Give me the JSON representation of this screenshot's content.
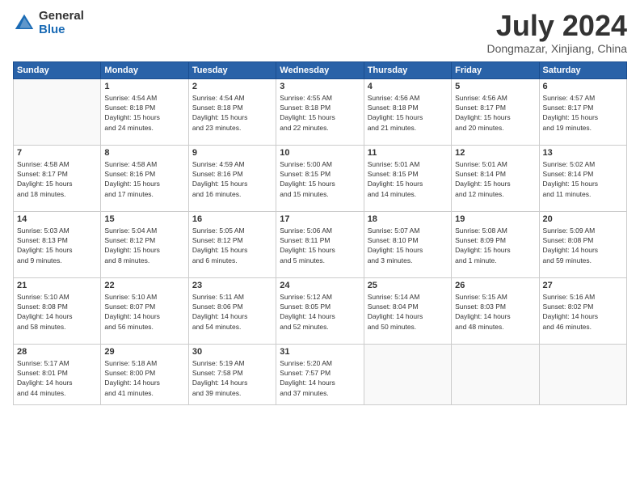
{
  "logo": {
    "general": "General",
    "blue": "Blue"
  },
  "title": "July 2024",
  "subtitle": "Dongmazar, Xinjiang, China",
  "weekdays": [
    "Sunday",
    "Monday",
    "Tuesday",
    "Wednesday",
    "Thursday",
    "Friday",
    "Saturday"
  ],
  "weeks": [
    [
      {
        "day": "",
        "info": ""
      },
      {
        "day": "1",
        "info": "Sunrise: 4:54 AM\nSunset: 8:18 PM\nDaylight: 15 hours\nand 24 minutes."
      },
      {
        "day": "2",
        "info": "Sunrise: 4:54 AM\nSunset: 8:18 PM\nDaylight: 15 hours\nand 23 minutes."
      },
      {
        "day": "3",
        "info": "Sunrise: 4:55 AM\nSunset: 8:18 PM\nDaylight: 15 hours\nand 22 minutes."
      },
      {
        "day": "4",
        "info": "Sunrise: 4:56 AM\nSunset: 8:18 PM\nDaylight: 15 hours\nand 21 minutes."
      },
      {
        "day": "5",
        "info": "Sunrise: 4:56 AM\nSunset: 8:17 PM\nDaylight: 15 hours\nand 20 minutes."
      },
      {
        "day": "6",
        "info": "Sunrise: 4:57 AM\nSunset: 8:17 PM\nDaylight: 15 hours\nand 19 minutes."
      }
    ],
    [
      {
        "day": "7",
        "info": "Sunrise: 4:58 AM\nSunset: 8:17 PM\nDaylight: 15 hours\nand 18 minutes."
      },
      {
        "day": "8",
        "info": "Sunrise: 4:58 AM\nSunset: 8:16 PM\nDaylight: 15 hours\nand 17 minutes."
      },
      {
        "day": "9",
        "info": "Sunrise: 4:59 AM\nSunset: 8:16 PM\nDaylight: 15 hours\nand 16 minutes."
      },
      {
        "day": "10",
        "info": "Sunrise: 5:00 AM\nSunset: 8:15 PM\nDaylight: 15 hours\nand 15 minutes."
      },
      {
        "day": "11",
        "info": "Sunrise: 5:01 AM\nSunset: 8:15 PM\nDaylight: 15 hours\nand 14 minutes."
      },
      {
        "day": "12",
        "info": "Sunrise: 5:01 AM\nSunset: 8:14 PM\nDaylight: 15 hours\nand 12 minutes."
      },
      {
        "day": "13",
        "info": "Sunrise: 5:02 AM\nSunset: 8:14 PM\nDaylight: 15 hours\nand 11 minutes."
      }
    ],
    [
      {
        "day": "14",
        "info": "Sunrise: 5:03 AM\nSunset: 8:13 PM\nDaylight: 15 hours\nand 9 minutes."
      },
      {
        "day": "15",
        "info": "Sunrise: 5:04 AM\nSunset: 8:12 PM\nDaylight: 15 hours\nand 8 minutes."
      },
      {
        "day": "16",
        "info": "Sunrise: 5:05 AM\nSunset: 8:12 PM\nDaylight: 15 hours\nand 6 minutes."
      },
      {
        "day": "17",
        "info": "Sunrise: 5:06 AM\nSunset: 8:11 PM\nDaylight: 15 hours\nand 5 minutes."
      },
      {
        "day": "18",
        "info": "Sunrise: 5:07 AM\nSunset: 8:10 PM\nDaylight: 15 hours\nand 3 minutes."
      },
      {
        "day": "19",
        "info": "Sunrise: 5:08 AM\nSunset: 8:09 PM\nDaylight: 15 hours\nand 1 minute."
      },
      {
        "day": "20",
        "info": "Sunrise: 5:09 AM\nSunset: 8:08 PM\nDaylight: 14 hours\nand 59 minutes."
      }
    ],
    [
      {
        "day": "21",
        "info": "Sunrise: 5:10 AM\nSunset: 8:08 PM\nDaylight: 14 hours\nand 58 minutes."
      },
      {
        "day": "22",
        "info": "Sunrise: 5:10 AM\nSunset: 8:07 PM\nDaylight: 14 hours\nand 56 minutes."
      },
      {
        "day": "23",
        "info": "Sunrise: 5:11 AM\nSunset: 8:06 PM\nDaylight: 14 hours\nand 54 minutes."
      },
      {
        "day": "24",
        "info": "Sunrise: 5:12 AM\nSunset: 8:05 PM\nDaylight: 14 hours\nand 52 minutes."
      },
      {
        "day": "25",
        "info": "Sunrise: 5:14 AM\nSunset: 8:04 PM\nDaylight: 14 hours\nand 50 minutes."
      },
      {
        "day": "26",
        "info": "Sunrise: 5:15 AM\nSunset: 8:03 PM\nDaylight: 14 hours\nand 48 minutes."
      },
      {
        "day": "27",
        "info": "Sunrise: 5:16 AM\nSunset: 8:02 PM\nDaylight: 14 hours\nand 46 minutes."
      }
    ],
    [
      {
        "day": "28",
        "info": "Sunrise: 5:17 AM\nSunset: 8:01 PM\nDaylight: 14 hours\nand 44 minutes."
      },
      {
        "day": "29",
        "info": "Sunrise: 5:18 AM\nSunset: 8:00 PM\nDaylight: 14 hours\nand 41 minutes."
      },
      {
        "day": "30",
        "info": "Sunrise: 5:19 AM\nSunset: 7:58 PM\nDaylight: 14 hours\nand 39 minutes."
      },
      {
        "day": "31",
        "info": "Sunrise: 5:20 AM\nSunset: 7:57 PM\nDaylight: 14 hours\nand 37 minutes."
      },
      {
        "day": "",
        "info": ""
      },
      {
        "day": "",
        "info": ""
      },
      {
        "day": "",
        "info": ""
      }
    ]
  ]
}
